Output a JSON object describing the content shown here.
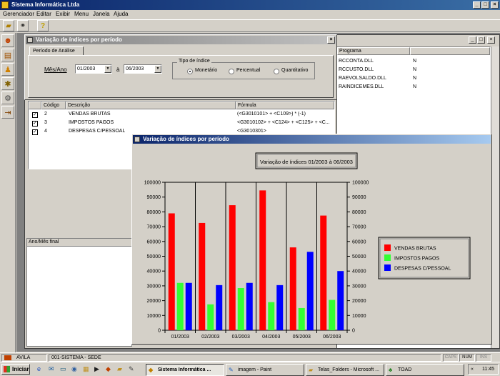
{
  "app": {
    "title": "Sistema Informática Ltda"
  },
  "menu": [
    "Gerenciador",
    "Editar",
    "Exibir",
    "Menu",
    "Janela",
    "Ajuda"
  ],
  "dialog": {
    "title": "Variação de índices por período",
    "tab": "Período de Análise",
    "mes_ano_label": "Mês/Ano",
    "from": "01/2003",
    "a_label": "à",
    "to": "06/2003",
    "tipo_label": "Tipo de índice",
    "options": [
      "Monetário",
      "Percentual",
      "Quantitativo"
    ],
    "selected": 0
  },
  "grid": {
    "headers": [
      "Código",
      "Descrição",
      "Fórmula"
    ],
    "rows": [
      {
        "code": "2",
        "desc": "VENDAS BRUTAS",
        "formula": "(<G3010101> + <C109>) * (-1)",
        "checked": true
      },
      {
        "code": "3",
        "desc": "IMPOSTOS PAGOS",
        "formula": "<G3010102> + <C124> + <C125> + <C...",
        "checked": true
      },
      {
        "code": "4",
        "desc": "DESPESAS C/PESSOAL",
        "formula": "<G3010301>",
        "checked": true
      }
    ],
    "ano_mes_final": "Ano/Mês final"
  },
  "right_list": {
    "header": "Programa",
    "rows": [
      {
        "name": "RCCONTA.DLL",
        "flag": "N"
      },
      {
        "name": "RCCUSTO.DLL",
        "flag": "N"
      },
      {
        "name": "RAEVOLSALDO.DLL",
        "flag": "N"
      },
      {
        "name": "RAINDICEMES.DLL",
        "flag": "N"
      }
    ]
  },
  "chart_window": {
    "title": "Variação de índices por período"
  },
  "chart_data": {
    "type": "bar",
    "title": "Variação de índices 01/2003 à 06/2003",
    "categories": [
      "01/2003",
      "02/2003",
      "03/2003",
      "04/2003",
      "05/2003",
      "06/2003"
    ],
    "series": [
      {
        "name": "VENDAS BRUTAS",
        "color": "#ff0000",
        "values": [
          79000,
          72500,
          84500,
          94500,
          56000,
          77500
        ]
      },
      {
        "name": "IMPOSTOS PAGOS",
        "color": "#33ff33",
        "values": [
          32000,
          17500,
          28500,
          19000,
          15000,
          20500
        ]
      },
      {
        "name": "DESPESAS C/PESSOAL",
        "color": "#0000ff",
        "values": [
          32000,
          30500,
          32000,
          30500,
          53000,
          40000
        ]
      }
    ],
    "ylim": [
      0,
      100000
    ],
    "yticks": [
      "0",
      "10000",
      "20000",
      "30000",
      "40000",
      "50000",
      "60000",
      "70000",
      "80000",
      "90000",
      "100000"
    ],
    "grid": true,
    "legend": "right"
  },
  "status": {
    "user": "AVILA",
    "company": "001-SISTEMA - SEDE",
    "caps": "CAPS",
    "num": "NUM",
    "ins": "INS"
  },
  "taskbar": {
    "start": "Iniciar",
    "buttons": [
      "Sistema Informática ...",
      "imagem - Paint",
      "Telas_Folders - Microsoft ...",
      "TOAD"
    ],
    "clock": "11:45"
  }
}
